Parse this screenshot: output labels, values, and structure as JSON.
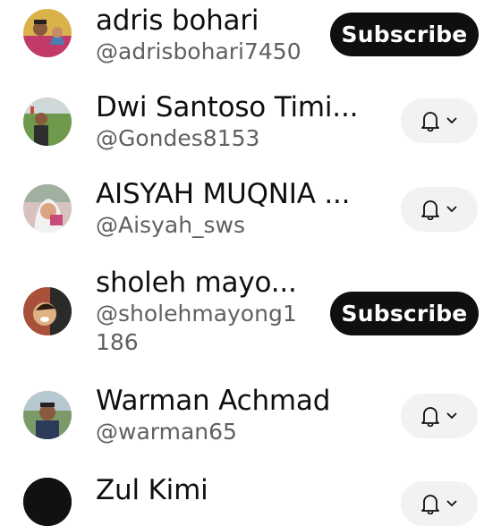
{
  "subscriptions": [
    {
      "name": "adris bohari",
      "handle": "@adrisbohari7450",
      "button": "Subscribe",
      "state": "subscribe",
      "avatar_icon": "couple-photo-avatar"
    },
    {
      "name": "Dwi Santoso Timi...",
      "handle": "@Gondes8153",
      "state": "subscribed",
      "avatar_icon": "field-photo-avatar"
    },
    {
      "name": "AISYAH MUQNIA ...",
      "handle": "@Aisyah_sws",
      "state": "subscribed",
      "avatar_icon": "woman-photo-avatar"
    },
    {
      "name": "sholeh mayo...",
      "handle_line1": "@sholehmayong1",
      "handle_line2": "186",
      "button": "Subscribe",
      "state": "subscribe",
      "avatar_icon": "man-photo-avatar"
    },
    {
      "name": "Warman Achmad",
      "handle": "@warman65",
      "state": "subscribed",
      "avatar_icon": "man-outdoor-avatar"
    },
    {
      "name": "Zul Kimi",
      "state": "subscribed",
      "avatar_icon": "dark-avatar"
    }
  ],
  "colors": {
    "button_dark": "#0f0f0f",
    "button_light": "#f2f2f2",
    "secondary_text": "#606060"
  }
}
